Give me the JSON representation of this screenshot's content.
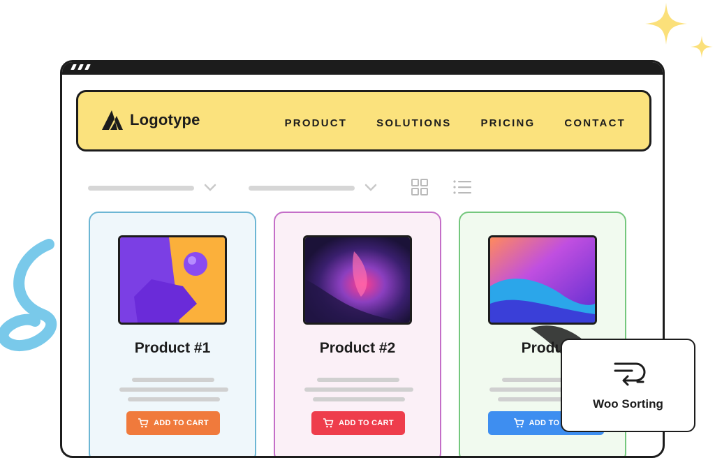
{
  "brand": {
    "name": "Logotype"
  },
  "nav": {
    "links": [
      "PRODUCT",
      "SOLUTIONS",
      "PRICING",
      "CONTACT"
    ]
  },
  "toolbar": {
    "view_modes": [
      "grid-view",
      "list-view"
    ]
  },
  "products": [
    {
      "title": "Product #1",
      "button": "ADD TO CART",
      "button_color": "#f07a3c",
      "border_color": "#6cb6d4",
      "bg_color": "#eff7fb"
    },
    {
      "title": "Product #2",
      "button": "ADD TO CART",
      "button_color": "#ee3d4c",
      "border_color": "#c46ec8",
      "bg_color": "#fbf0f7"
    },
    {
      "title": "Produ",
      "button": "ADD TO CAR",
      "button_color": "#3e8ef0",
      "border_color": "#74c77d",
      "bg_color": "#f1faef"
    }
  ],
  "woo_popup": {
    "label": "Woo Sorting",
    "icon": "sort-icon"
  },
  "colors": {
    "nav_bg": "#fbe27d",
    "outline": "#1c1c1c",
    "sparkle": "#fbe07a",
    "squiggle": "#79c9ea"
  }
}
